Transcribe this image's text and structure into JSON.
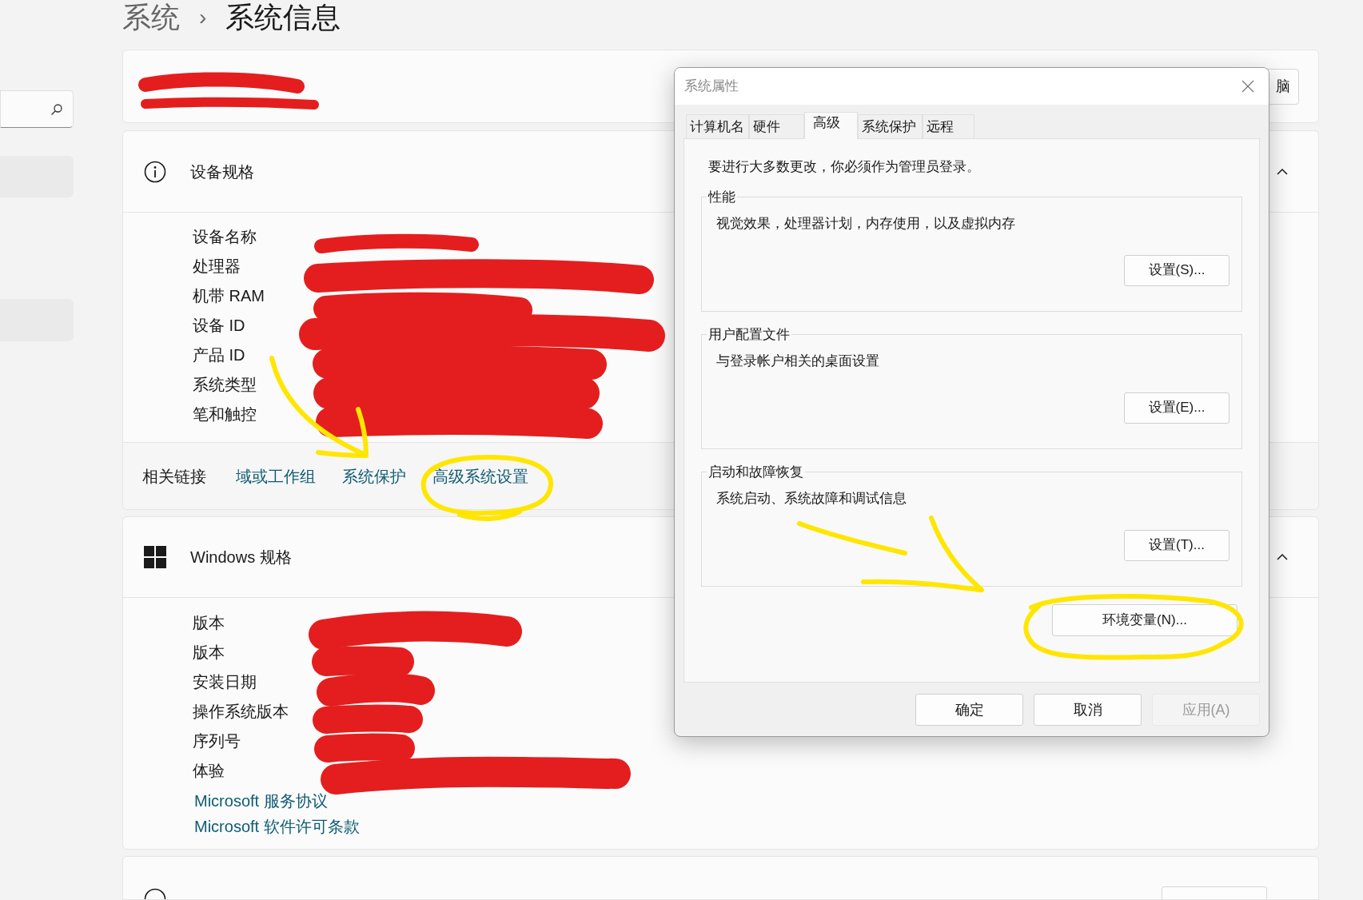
{
  "breadcrumb": {
    "parent": "系统",
    "separator": "›",
    "current": "系统信息"
  },
  "top_card": {
    "button_label": "脑"
  },
  "device_specs": {
    "title": "设备规格",
    "expanded": true,
    "rows": [
      {
        "label": "设备名称"
      },
      {
        "label": "处理器"
      },
      {
        "label": "机带 RAM"
      },
      {
        "label": "设备 ID"
      },
      {
        "label": "产品 ID"
      },
      {
        "label": "系统类型"
      },
      {
        "label": "笔和触控"
      }
    ],
    "related_label": "相关链接",
    "related_links": [
      "域或工作组",
      "系统保护",
      "高级系统设置"
    ]
  },
  "windows_specs": {
    "title": "Windows 规格",
    "expanded": true,
    "rows": [
      {
        "label": "版本"
      },
      {
        "label": "版本"
      },
      {
        "label": "安装日期"
      },
      {
        "label": "操作系统版本"
      },
      {
        "label": "序列号"
      },
      {
        "label": "体验"
      }
    ],
    "links": [
      "Microsoft 服务协议",
      "Microsoft 软件许可条款"
    ]
  },
  "dialog": {
    "title": "系统属性",
    "tabs": [
      {
        "label": "计算机名",
        "selected": false
      },
      {
        "label": "硬件",
        "selected": false
      },
      {
        "label": "高级",
        "selected": true
      },
      {
        "label": "系统保护",
        "selected": false
      },
      {
        "label": "远程",
        "selected": false
      }
    ],
    "notice": "要进行大多数更改，你必须作为管理员登录。",
    "groups": [
      {
        "title": "性能",
        "description": "视觉效果，处理器计划，内存使用，以及虚拟内存",
        "button": "设置(S)..."
      },
      {
        "title": "用户配置文件",
        "description": "与登录帐户相关的桌面设置",
        "button": "设置(E)..."
      },
      {
        "title": "启动和故障恢复",
        "description": "系统启动、系统故障和调试信息",
        "button": "设置(T)..."
      }
    ],
    "env_button": "环境变量(N)...",
    "buttons": [
      {
        "label": "确定",
        "disabled": false
      },
      {
        "label": "取消",
        "disabled": false
      },
      {
        "label": "应用(A)",
        "disabled": true
      }
    ]
  }
}
